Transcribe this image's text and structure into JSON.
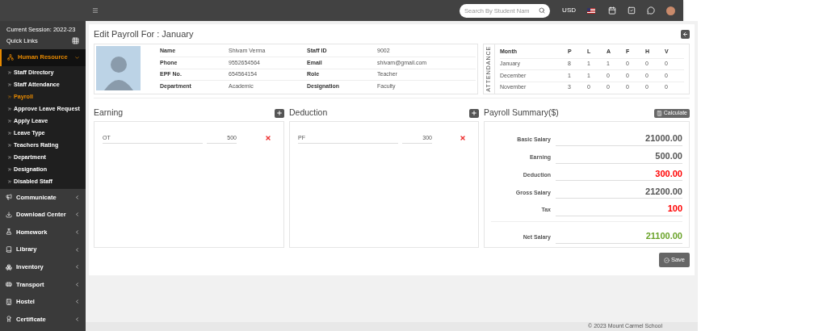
{
  "topbar": {
    "search": {
      "placeholder": "Search By Student Nam"
    },
    "currency": "USD"
  },
  "sidebar": {
    "session": "Current Session: 2022-23",
    "quick_links": "Quick Links",
    "items": [
      {
        "label": "Human Resource",
        "kind": "hr",
        "expanded": true,
        "children": [
          {
            "label": "Staff Directory",
            "selected": false
          },
          {
            "label": "Staff Attendance",
            "selected": false
          },
          {
            "label": "Payroll",
            "selected": true
          },
          {
            "label": "Approve Leave Request",
            "selected": false
          },
          {
            "label": "Apply Leave",
            "selected": false
          },
          {
            "label": "Leave Type",
            "selected": false
          },
          {
            "label": "Teachers Rating",
            "selected": false
          },
          {
            "label": "Department",
            "selected": false
          },
          {
            "label": "Designation",
            "selected": false
          },
          {
            "label": "Disabled Staff",
            "selected": false
          }
        ]
      },
      {
        "label": "Communicate",
        "kind": "megaphone",
        "expanded": false
      },
      {
        "label": "Download Center",
        "kind": "download",
        "expanded": false
      },
      {
        "label": "Homework",
        "kind": "homework",
        "expanded": false
      },
      {
        "label": "Library",
        "kind": "book",
        "expanded": false
      },
      {
        "label": "Inventory",
        "kind": "inventory",
        "expanded": false
      },
      {
        "label": "Transport",
        "kind": "bus",
        "expanded": false
      },
      {
        "label": "Hostel",
        "kind": "building",
        "expanded": false
      },
      {
        "label": "Certificate",
        "kind": "certificate",
        "expanded": false
      }
    ]
  },
  "page": {
    "title": "Edit Payroll For : January",
    "staff": [
      [
        "Name",
        "Shivam Verma",
        "Staff ID",
        "9002"
      ],
      [
        "Phone",
        "9552654564",
        "Email",
        "shivam@gmail.com"
      ],
      [
        "EPF No.",
        "654564154",
        "Role",
        "Teacher"
      ],
      [
        "Department",
        "Academic",
        "Designation",
        "Faculty"
      ]
    ],
    "attendance": {
      "label": "ATTENDANCE",
      "columns": [
        "Month",
        "P",
        "L",
        "A",
        "F",
        "H",
        "V"
      ],
      "rows": [
        [
          "January",
          "8",
          "1",
          "1",
          "0",
          "0",
          "0"
        ],
        [
          "December",
          "1",
          "1",
          "0",
          "0",
          "0",
          "0"
        ],
        [
          "November",
          "3",
          "0",
          "0",
          "0",
          "0",
          "0"
        ]
      ]
    },
    "earning": {
      "title": "Earning",
      "rows": [
        {
          "name": "OT",
          "amount": "500"
        }
      ]
    },
    "deduction": {
      "title": "Deduction",
      "rows": [
        {
          "name": "PF",
          "amount": "300"
        }
      ]
    },
    "summary": {
      "title": "Payroll Summary($)",
      "calculate": "Calculate",
      "rows": [
        {
          "label": "Basic Salary",
          "value": "21000.00",
          "kind": "amount"
        },
        {
          "label": "Earning",
          "value": "500.00",
          "kind": "amount"
        },
        {
          "label": "Deduction",
          "value": "300.00",
          "kind": "minus"
        },
        {
          "label": "Gross Salary",
          "value": "21200.00",
          "kind": "amount"
        },
        {
          "label": "Tax",
          "value": "100",
          "kind": "minus"
        },
        {
          "label": "Net Salary",
          "value": "21100.00",
          "kind": "net"
        }
      ]
    },
    "save": "Save"
  },
  "footer": "© 2023 Mount Carmel School"
}
